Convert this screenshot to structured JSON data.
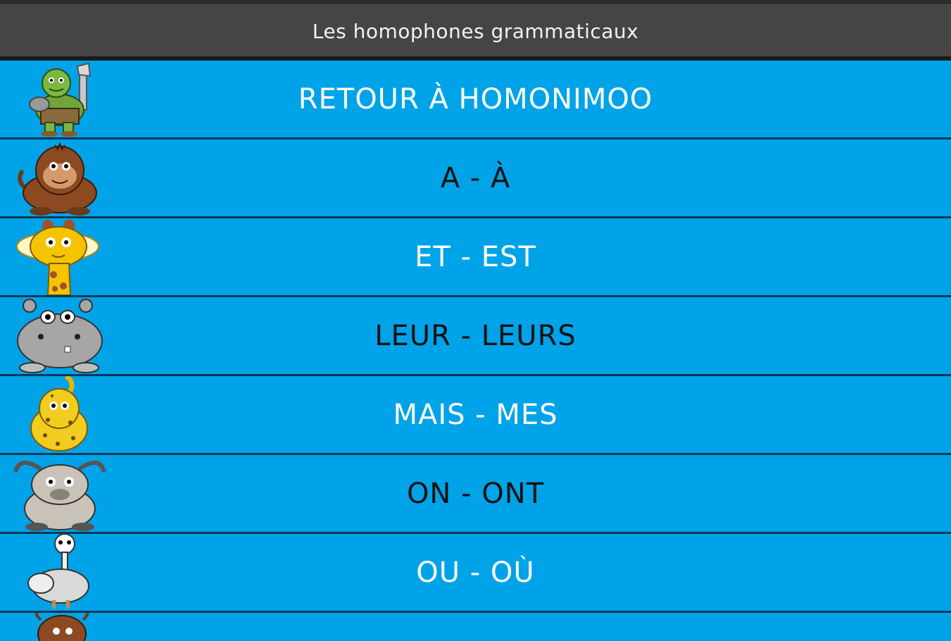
{
  "app": {
    "title": "Les homophones grammaticaux"
  },
  "rows": [
    {
      "label": "RETOUR À HOMONIMOO",
      "icon": "ogre-icon",
      "text_color": "#ffffff"
    },
    {
      "label": "A - À",
      "icon": "monkey-icon",
      "text_color": "#111111"
    },
    {
      "label": "ET - EST",
      "icon": "giraffe-icon",
      "text_color": "#ffffff"
    },
    {
      "label": "LEUR - LEURS",
      "icon": "hippo-icon",
      "text_color": "#111111"
    },
    {
      "label": "MAIS - MES",
      "icon": "leopard-icon",
      "text_color": "#ffffff"
    },
    {
      "label": "ON - ONT",
      "icon": "goat-icon",
      "text_color": "#111111"
    },
    {
      "label": "OU - OÙ",
      "icon": "ostrich-icon",
      "text_color": "#ffffff"
    },
    {
      "label": "",
      "icon": "cow-icon",
      "text_color": "#111111"
    }
  ],
  "colors": {
    "row_bg": "#00a3e8",
    "title_bg": "#454545",
    "divider": "#0a3a55"
  }
}
